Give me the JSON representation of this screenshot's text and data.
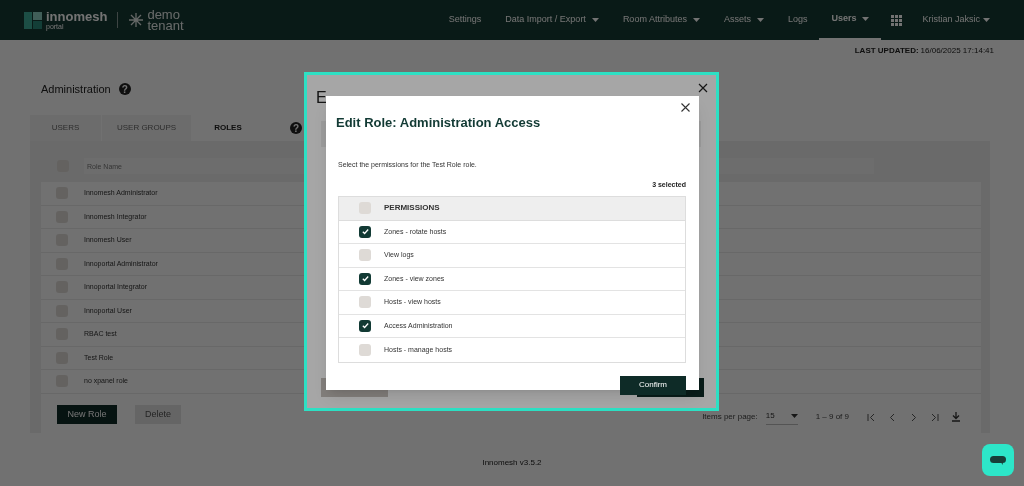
{
  "header": {
    "logo_name": "innomesh",
    "logo_sub": "portal",
    "tenant": [
      "demo",
      "tenant"
    ],
    "nav": [
      {
        "label": "Settings",
        "dropdown": false,
        "selected": false
      },
      {
        "label": "Data Import / Export",
        "dropdown": true,
        "selected": false
      },
      {
        "label": "Room Attributes",
        "dropdown": true,
        "selected": false
      },
      {
        "label": "Assets",
        "dropdown": true,
        "selected": false
      },
      {
        "label": "Logs",
        "dropdown": false,
        "selected": false
      },
      {
        "label": "Users",
        "dropdown": true,
        "selected": true
      }
    ],
    "user": "Kristian Jaksic"
  },
  "last_updated": {
    "label": "LAST UPDATED:",
    "value": "16/06/2025 17:14:41"
  },
  "page_title": "Administration",
  "help_glyph": "?",
  "tabs_help_glyph": "?",
  "tabs": [
    {
      "label": "USERS",
      "selected": false
    },
    {
      "label": "USER GROUPS",
      "selected": false
    },
    {
      "label": "ROLES",
      "selected": true
    }
  ],
  "table": {
    "header_checked": false,
    "filter": {
      "placeholder": "Role Name"
    },
    "rows": [
      {
        "name": "Innomesh Administrator",
        "checked": false
      },
      {
        "name": "Innomesh Integrator",
        "checked": false
      },
      {
        "name": "Innomesh User",
        "checked": false
      },
      {
        "name": "Innoportal Administrator",
        "checked": false
      },
      {
        "name": "Innoportal Integrator",
        "checked": false
      },
      {
        "name": "Innoportal User",
        "checked": false
      },
      {
        "name": "RBAC test",
        "checked": false
      },
      {
        "name": "Test Role",
        "checked": false
      },
      {
        "name": "no xpanel role",
        "checked": false
      }
    ]
  },
  "actions": [
    {
      "label": "New Role",
      "disabled": false
    },
    {
      "label": "Delete",
      "disabled": true
    }
  ],
  "pagination": {
    "items_per_page_label": "Items per page:",
    "items_per_page": "15",
    "range": "1 – 9 of 9"
  },
  "footer": "Innomesh v3.5.2",
  "outer_dialog": {
    "title": "E"
  },
  "dialog": {
    "title": "Edit Role: Administration Access",
    "description": "Select the permissions for the Test Role role.",
    "selected_count": "3 selected",
    "header_checked": false,
    "column": "PERMISSIONS",
    "permissions": [
      {
        "label": "Zones - rotate hosts",
        "checked": true
      },
      {
        "label": "View logs",
        "checked": false
      },
      {
        "label": "Zones - view zones",
        "checked": true
      },
      {
        "label": "Hosts - view hosts",
        "checked": false
      },
      {
        "label": "Access Administration",
        "checked": true
      },
      {
        "label": "Hosts - manage hosts",
        "checked": false
      }
    ],
    "confirm": "Confirm"
  }
}
